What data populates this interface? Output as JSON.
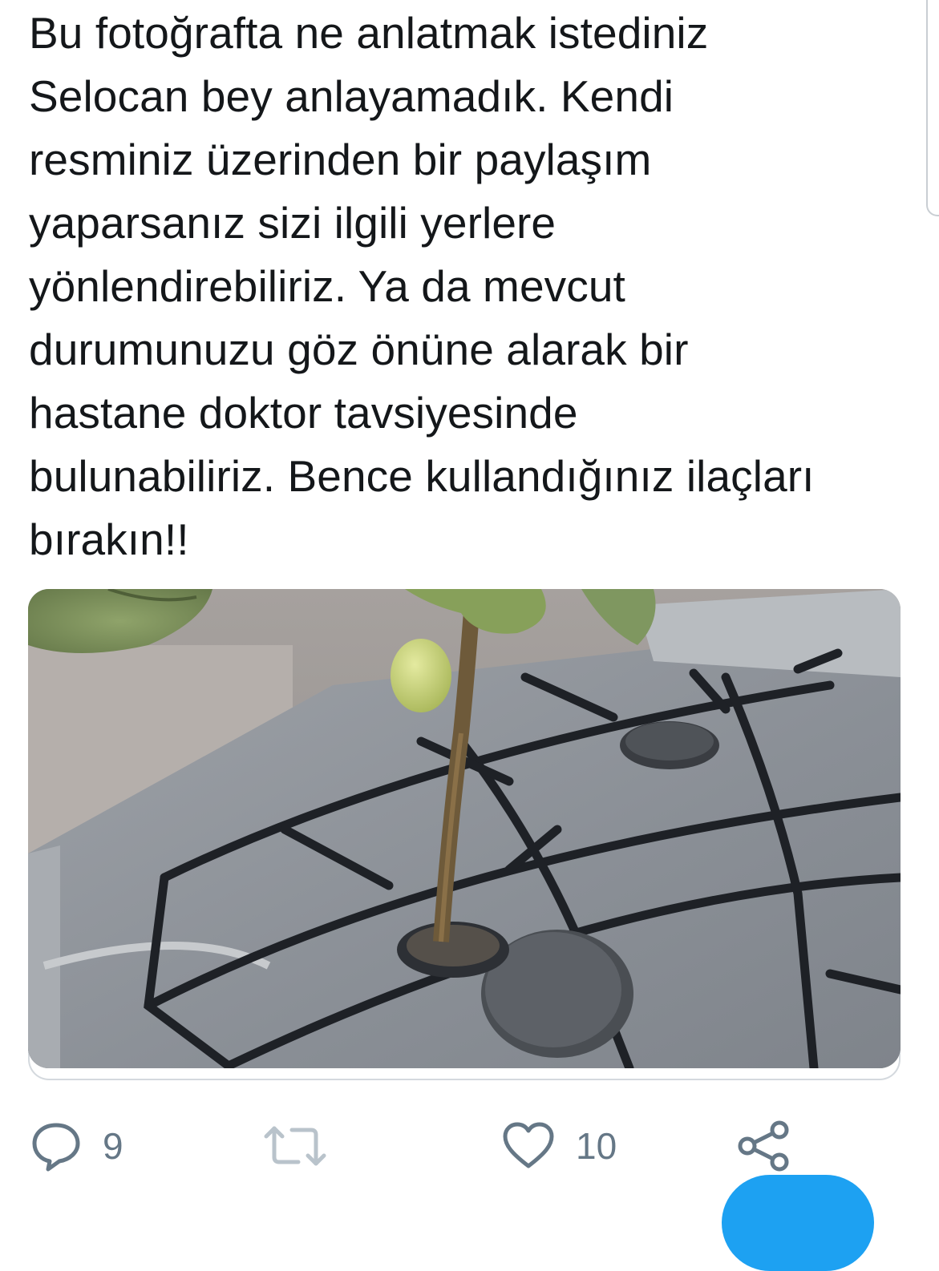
{
  "tweet": {
    "text_lines": [
      "Bu fotoğrafta ne anlatmak istediniz",
      "Selocan bey anlayamadık. Kendi",
      "resminiz üzerinden bir paylaşım",
      "yaparsanız sizi ilgili yerlere",
      "yönlendirebiliriz. Ya da mevcut",
      "durumunuzu göz önüne alarak bir",
      "hastane doktor tavsiyesinde",
      "bulunabiliriz. Bence kullandığınız ilaçları",
      "bırakın!!"
    ]
  },
  "actions": {
    "reply": {
      "icon": "reply-icon",
      "count": "9"
    },
    "retweet": {
      "icon": "retweet-icon",
      "count": ""
    },
    "like": {
      "icon": "heart-icon",
      "count": "10"
    },
    "share": {
      "icon": "share-icon"
    }
  },
  "colors": {
    "text": "#14171a",
    "action_gray": "#657786",
    "accent": "#1da1f2",
    "border": "#d4d9de"
  }
}
